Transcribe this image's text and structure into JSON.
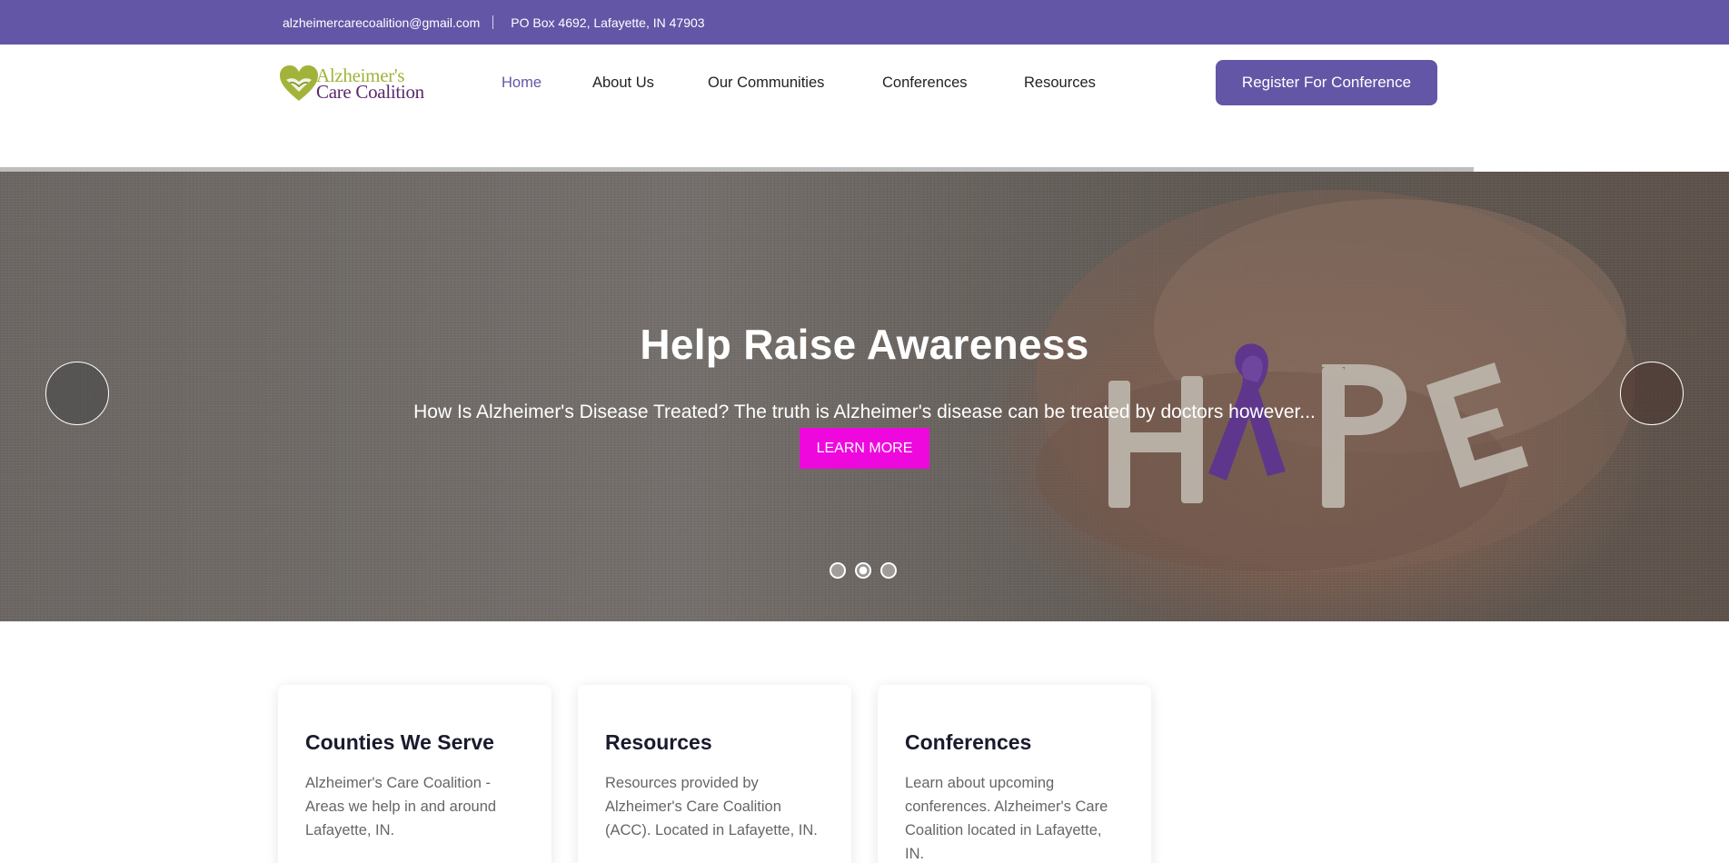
{
  "topbar": {
    "email": "alzheimercarecoalition@gmail.com",
    "address": "PO Box 4692, Lafayette, IN 47903"
  },
  "logo": {
    "line1": "Alzheimer's",
    "line2": "Care Coalition"
  },
  "nav": {
    "items": [
      {
        "label": "Home",
        "active": true
      },
      {
        "label": "About Us"
      },
      {
        "label": "Our Communities"
      },
      {
        "label": "Conferences"
      },
      {
        "label": "Resources"
      }
    ]
  },
  "cta": {
    "label": "Register For Conference"
  },
  "hero": {
    "title": "Help Raise Awareness",
    "subtitle": "How Is Alzheimer's Disease Treated? The truth is Alzheimer's disease can be treated by doctors however...",
    "button": "LEARN MORE",
    "active_slide": 2,
    "slide_count": 3
  },
  "cards": [
    {
      "title": "Counties We Serve",
      "text": "Alzheimer's Care Coalition - Areas we help in and around Lafayette, IN."
    },
    {
      "title": "Resources",
      "text": "Resources provided by Alzheimer's Care Coalition (ACC). Located in Lafayette, IN."
    },
    {
      "title": "Conferences",
      "text": "Learn about upcoming conferences. Alzheimer's Care Coalition located in Lafayette, IN."
    }
  ],
  "colors": {
    "brand": "#6356a6",
    "accent": "#ef08de",
    "logo_green": "#a3b33a",
    "logo_purple": "#5b2a6b"
  }
}
